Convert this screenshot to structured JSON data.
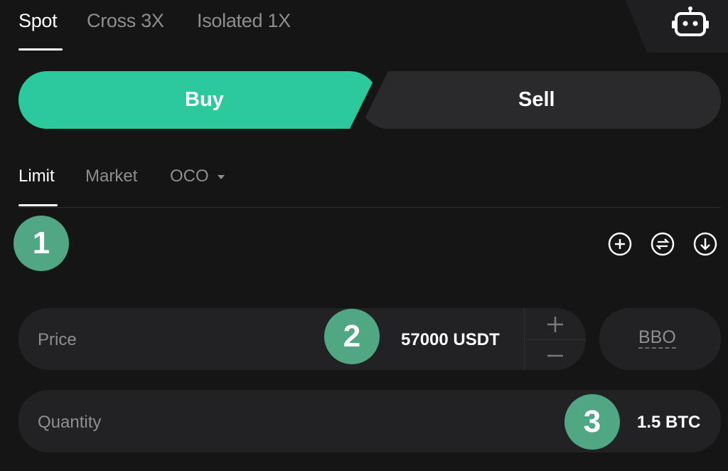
{
  "top_tabs": [
    {
      "label": "Spot",
      "active": true
    },
    {
      "label": "Cross 3X",
      "active": false
    },
    {
      "label": "Isolated 1X",
      "active": false
    }
  ],
  "robot": {
    "icon": "robot-icon"
  },
  "side": {
    "buy_label": "Buy",
    "sell_label": "Sell",
    "buy_color": "#2bc99b",
    "selected": "Buy"
  },
  "order_types": [
    {
      "label": "Limit",
      "active": true
    },
    {
      "label": "Market",
      "active": false
    },
    {
      "label": "OCO",
      "active": false,
      "dropdown": true
    }
  ],
  "tools": [
    {
      "icon": "plus-circle-icon"
    },
    {
      "icon": "swap-circle-icon"
    },
    {
      "icon": "download-circle-icon"
    }
  ],
  "badges": [
    "1",
    "2",
    "3"
  ],
  "price": {
    "label": "Price",
    "value": "57000 USDT"
  },
  "bbo": {
    "label": "BBO"
  },
  "quantity": {
    "label": "Quantity",
    "value": "1.5 BTC"
  },
  "colors": {
    "badge": "#4fa783",
    "background": "#151515",
    "field": "#222224"
  }
}
